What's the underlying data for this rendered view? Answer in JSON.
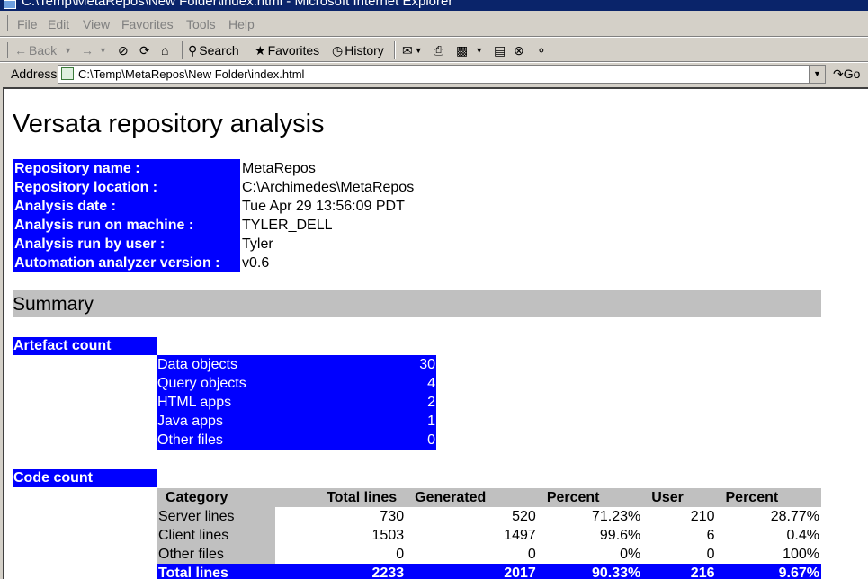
{
  "window": {
    "title": "C:\\Temp\\MetaRepos\\New Folder\\index.html - Microsoft Internet Explorer"
  },
  "menu": [
    "File",
    "Edit",
    "View",
    "Favorites",
    "Tools",
    "Help"
  ],
  "toolbar": {
    "back": "Back",
    "search": "Search",
    "favorites": "Favorites",
    "history": "History"
  },
  "address": {
    "label": "Address",
    "url": "C:\\Temp\\MetaRepos\\New Folder\\index.html",
    "go": "Go"
  },
  "page": {
    "heading": "Versata repository analysis",
    "info": [
      {
        "label": "Repository name :",
        "value": "MetaRepos"
      },
      {
        "label": "Repository location :",
        "value": "C:\\Archimedes\\MetaRepos"
      },
      {
        "label": "Analysis date :",
        "value": "Tue Apr 29 13:56:09 PDT"
      },
      {
        "label": "Analysis run on machine :",
        "value": "TYLER_DELL"
      },
      {
        "label": "Analysis run by user :",
        "value": "Tyler"
      },
      {
        "label": "Automation analyzer version :",
        "value": "v0.6"
      }
    ],
    "summary_title": "Summary",
    "artefact": {
      "title": "Artefact count",
      "rows": [
        {
          "name": "Data objects",
          "count": "30"
        },
        {
          "name": "Query objects",
          "count": "4"
        },
        {
          "name": "HTML apps",
          "count": "2"
        },
        {
          "name": "Java apps",
          "count": "1"
        },
        {
          "name": "Other files",
          "count": "0"
        }
      ]
    },
    "code": {
      "title": "Code count",
      "headers": [
        "Category",
        "Total lines",
        "Generated",
        "Percent",
        "User",
        "Percent"
      ],
      "rows": [
        [
          "Server lines",
          "730",
          "520",
          "71.23%",
          "210",
          "28.77%"
        ],
        [
          "Client lines",
          "1503",
          "1497",
          "99.6%",
          "6",
          "0.4%"
        ],
        [
          "Other files",
          "0",
          "0",
          "0%",
          "0",
          "100%"
        ]
      ],
      "total": [
        "Total lines",
        "2233",
        "2017",
        "90.33%",
        "216",
        "9.67%"
      ]
    }
  }
}
